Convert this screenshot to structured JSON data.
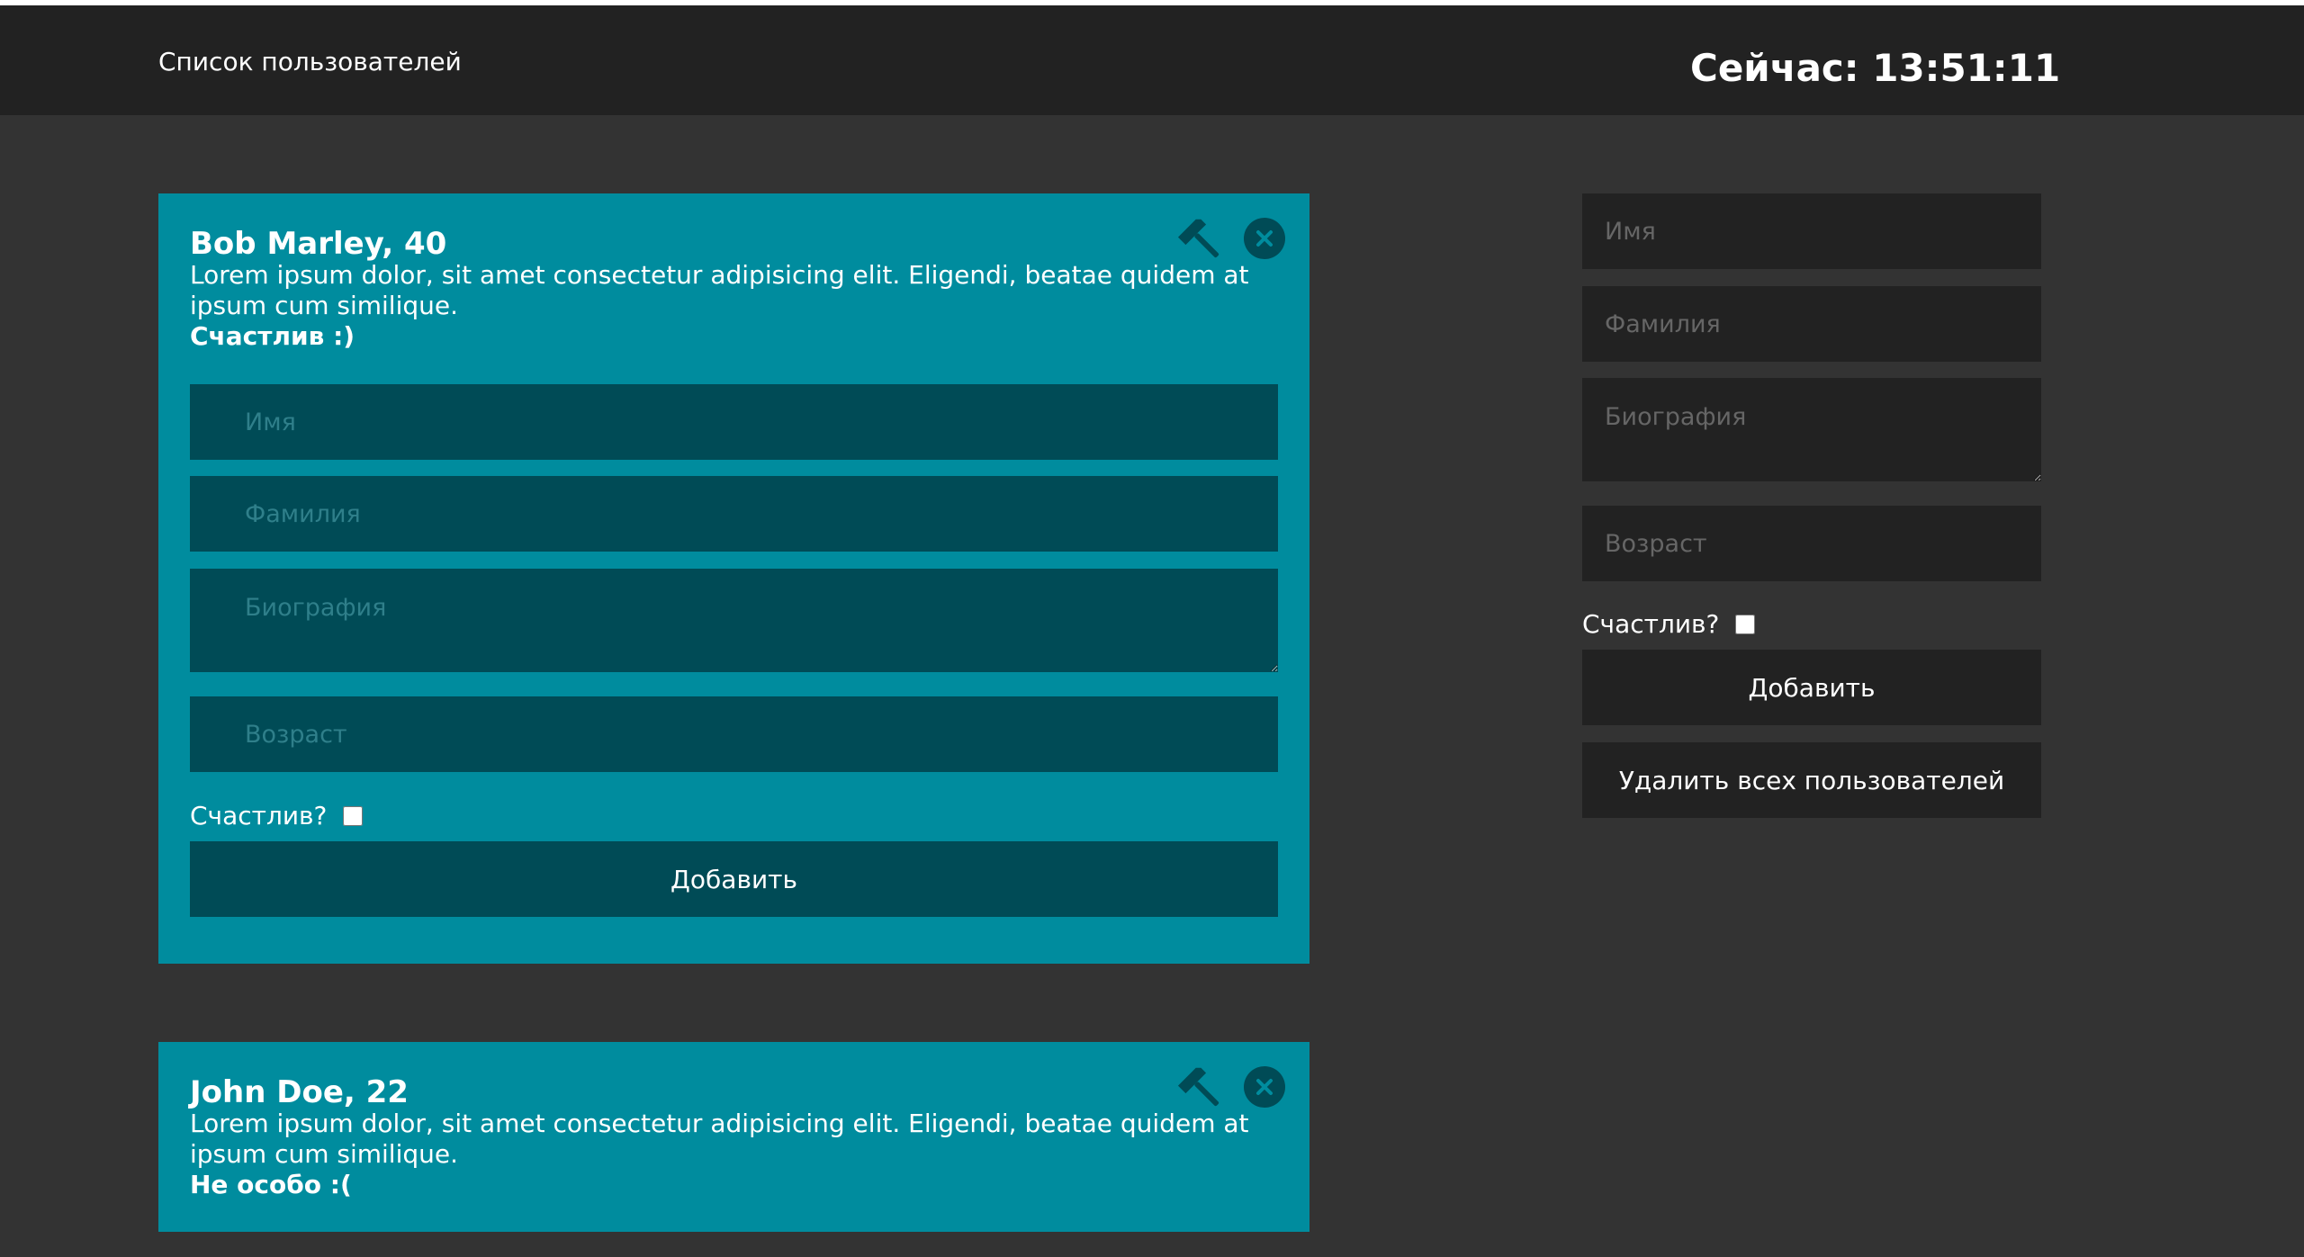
{
  "header": {
    "title": "Список пользователей",
    "clock": "Сейчас: 13:51:11"
  },
  "users": [
    {
      "name_age": "Bob Marley, 40",
      "bio": "Lorem ipsum dolor, sit amet consectetur adipisicing elit. Eligendi, beatae quidem at ipsum cum similique.",
      "status": "Счастлив :)",
      "editing": true,
      "edit_form": {
        "name_placeholder": "Имя",
        "surname_placeholder": "Фамилия",
        "bio_placeholder": "Биография",
        "age_placeholder": "Возраст",
        "happy_label": "Счастлив?",
        "happy_checked": false,
        "submit_label": "Добавить"
      }
    },
    {
      "name_age": "John Doe, 22",
      "bio": "Lorem ipsum dolor, sit amet consectetur adipisicing elit. Eligendi, beatae quidem at ipsum cum similique.",
      "status": "Не особо :(",
      "editing": false
    }
  ],
  "add_form": {
    "name_placeholder": "Имя",
    "surname_placeholder": "Фамилия",
    "bio_placeholder": "Биография",
    "age_placeholder": "Возраст",
    "happy_label": "Счастлив?",
    "happy_checked": false,
    "add_label": "Добавить",
    "delete_all_label": "Удалить всех пользователей"
  },
  "icons": {
    "edit": "hammer-icon",
    "delete": "close-icon"
  },
  "colors": {
    "background": "#333333",
    "header": "#222222",
    "card": "#008c9e",
    "card_field": "#004b56",
    "form_field": "#222222"
  }
}
